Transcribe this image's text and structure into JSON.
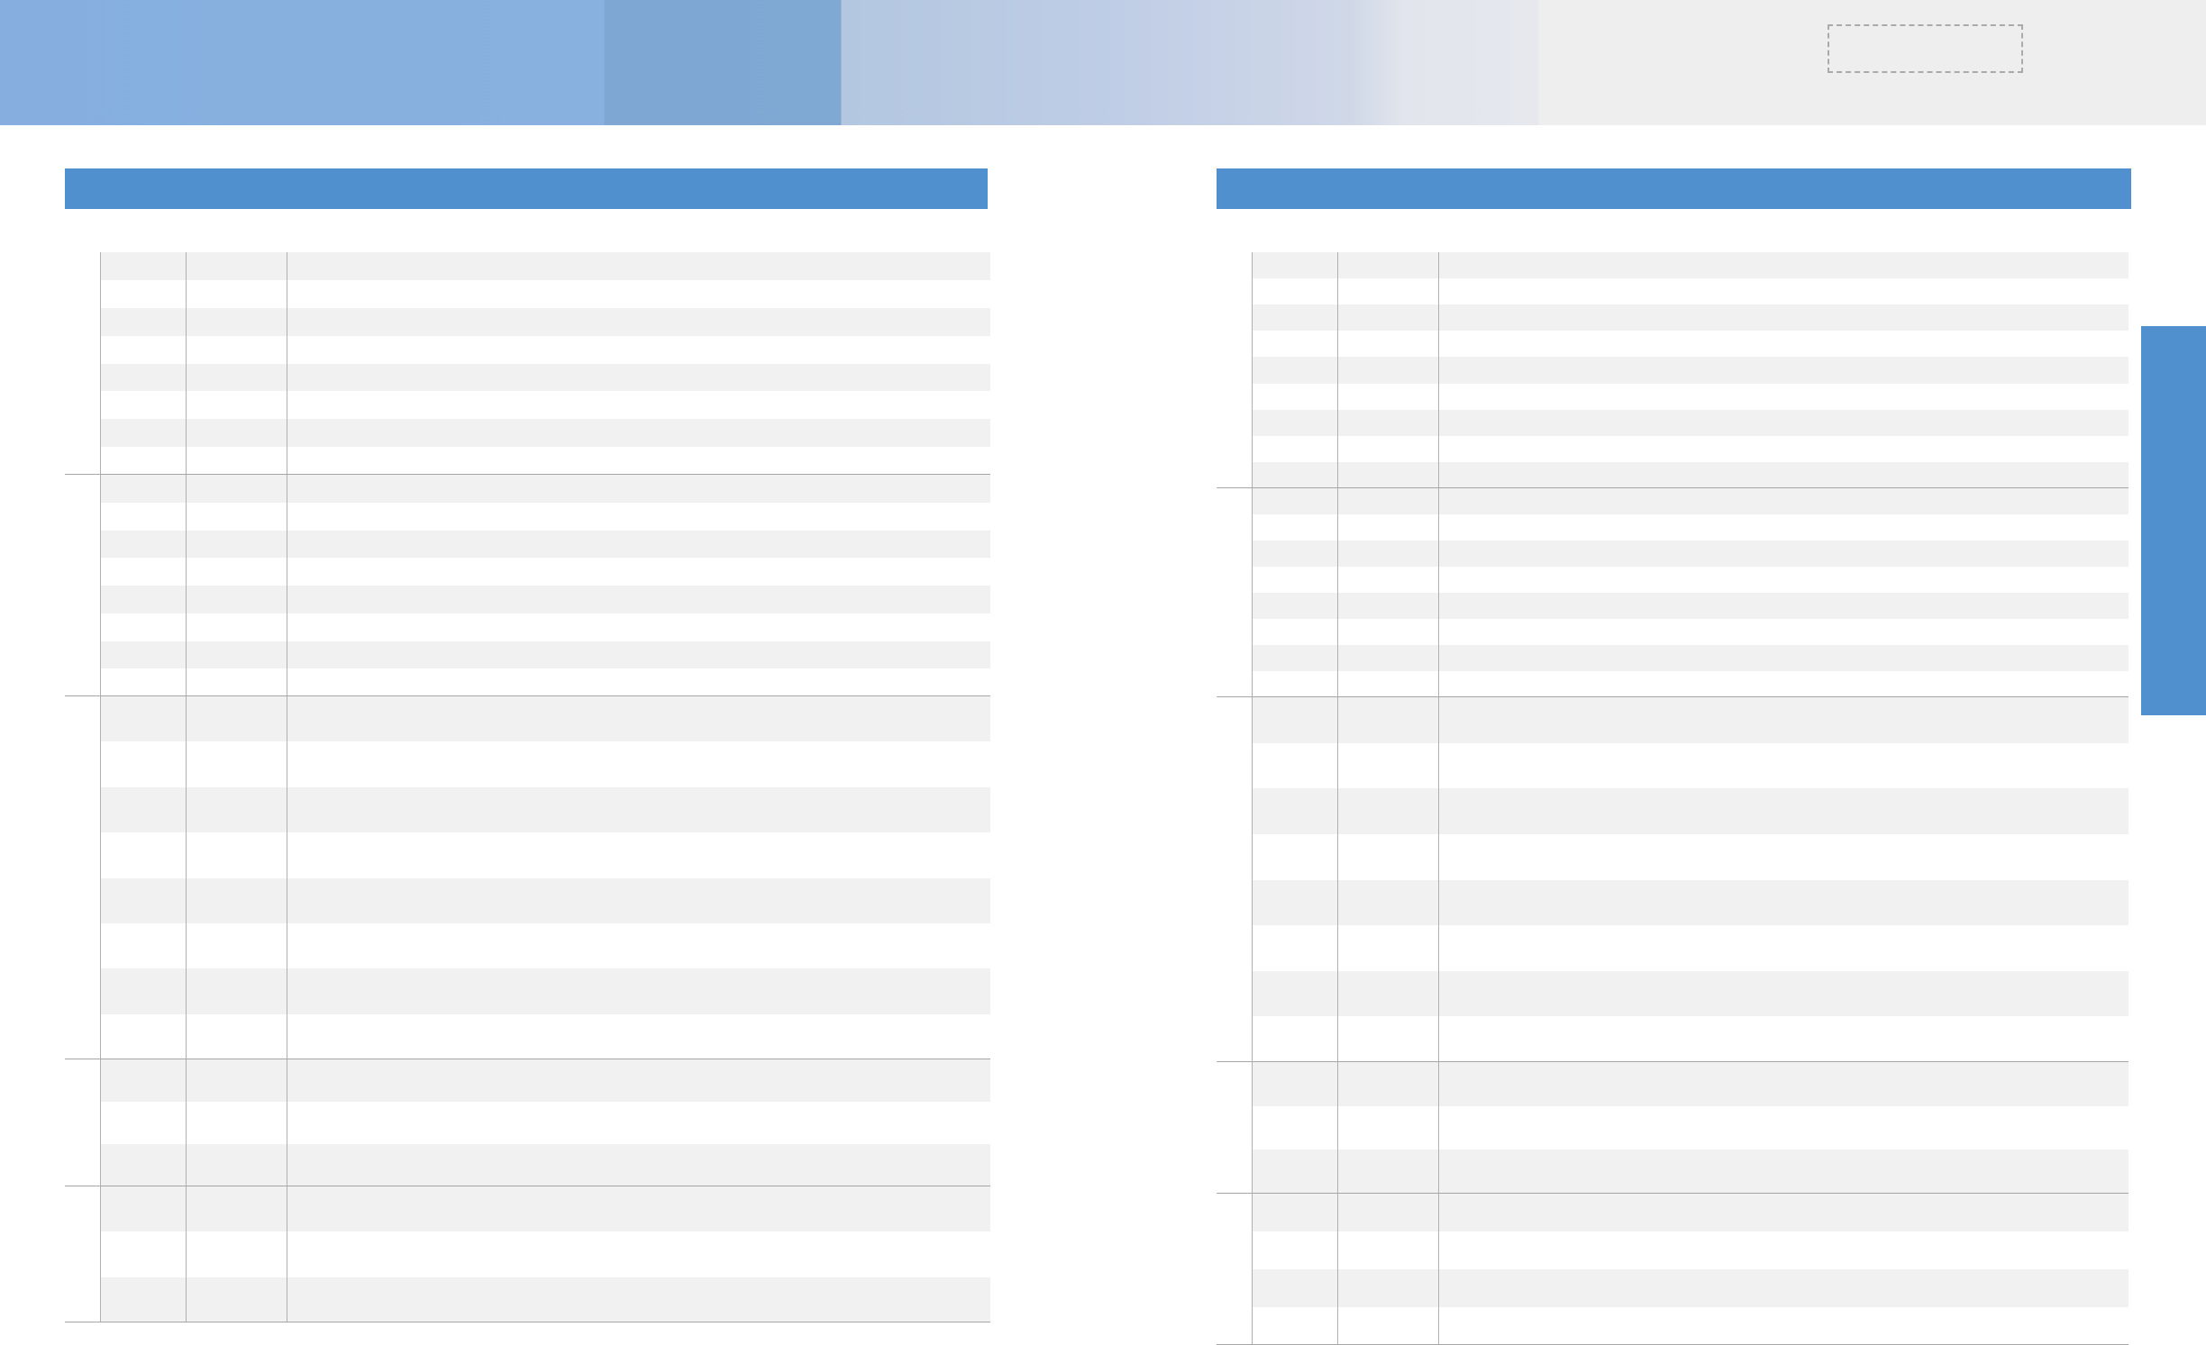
{
  "colors": {
    "accent_blue": "#5190cf",
    "row_shade": "#f1f1f1",
    "rule_gray": "#a6a6a6",
    "banner_background": "#eeeeee"
  },
  "header": {
    "banner_text": "",
    "label_placeholder": ""
  },
  "left_section": {
    "title": "",
    "groups": [
      {
        "rows": 8
      },
      {
        "rows": 8
      },
      {
        "rows": 8
      },
      {
        "rows": 3
      },
      {
        "rows": 3
      }
    ]
  },
  "right_section": {
    "title": "",
    "groups": [
      {
        "rows": 9
      },
      {
        "rows": 8
      },
      {
        "rows": 8
      },
      {
        "rows": 3
      },
      {
        "rows": 4
      }
    ]
  },
  "side_tab": {
    "label": ""
  }
}
